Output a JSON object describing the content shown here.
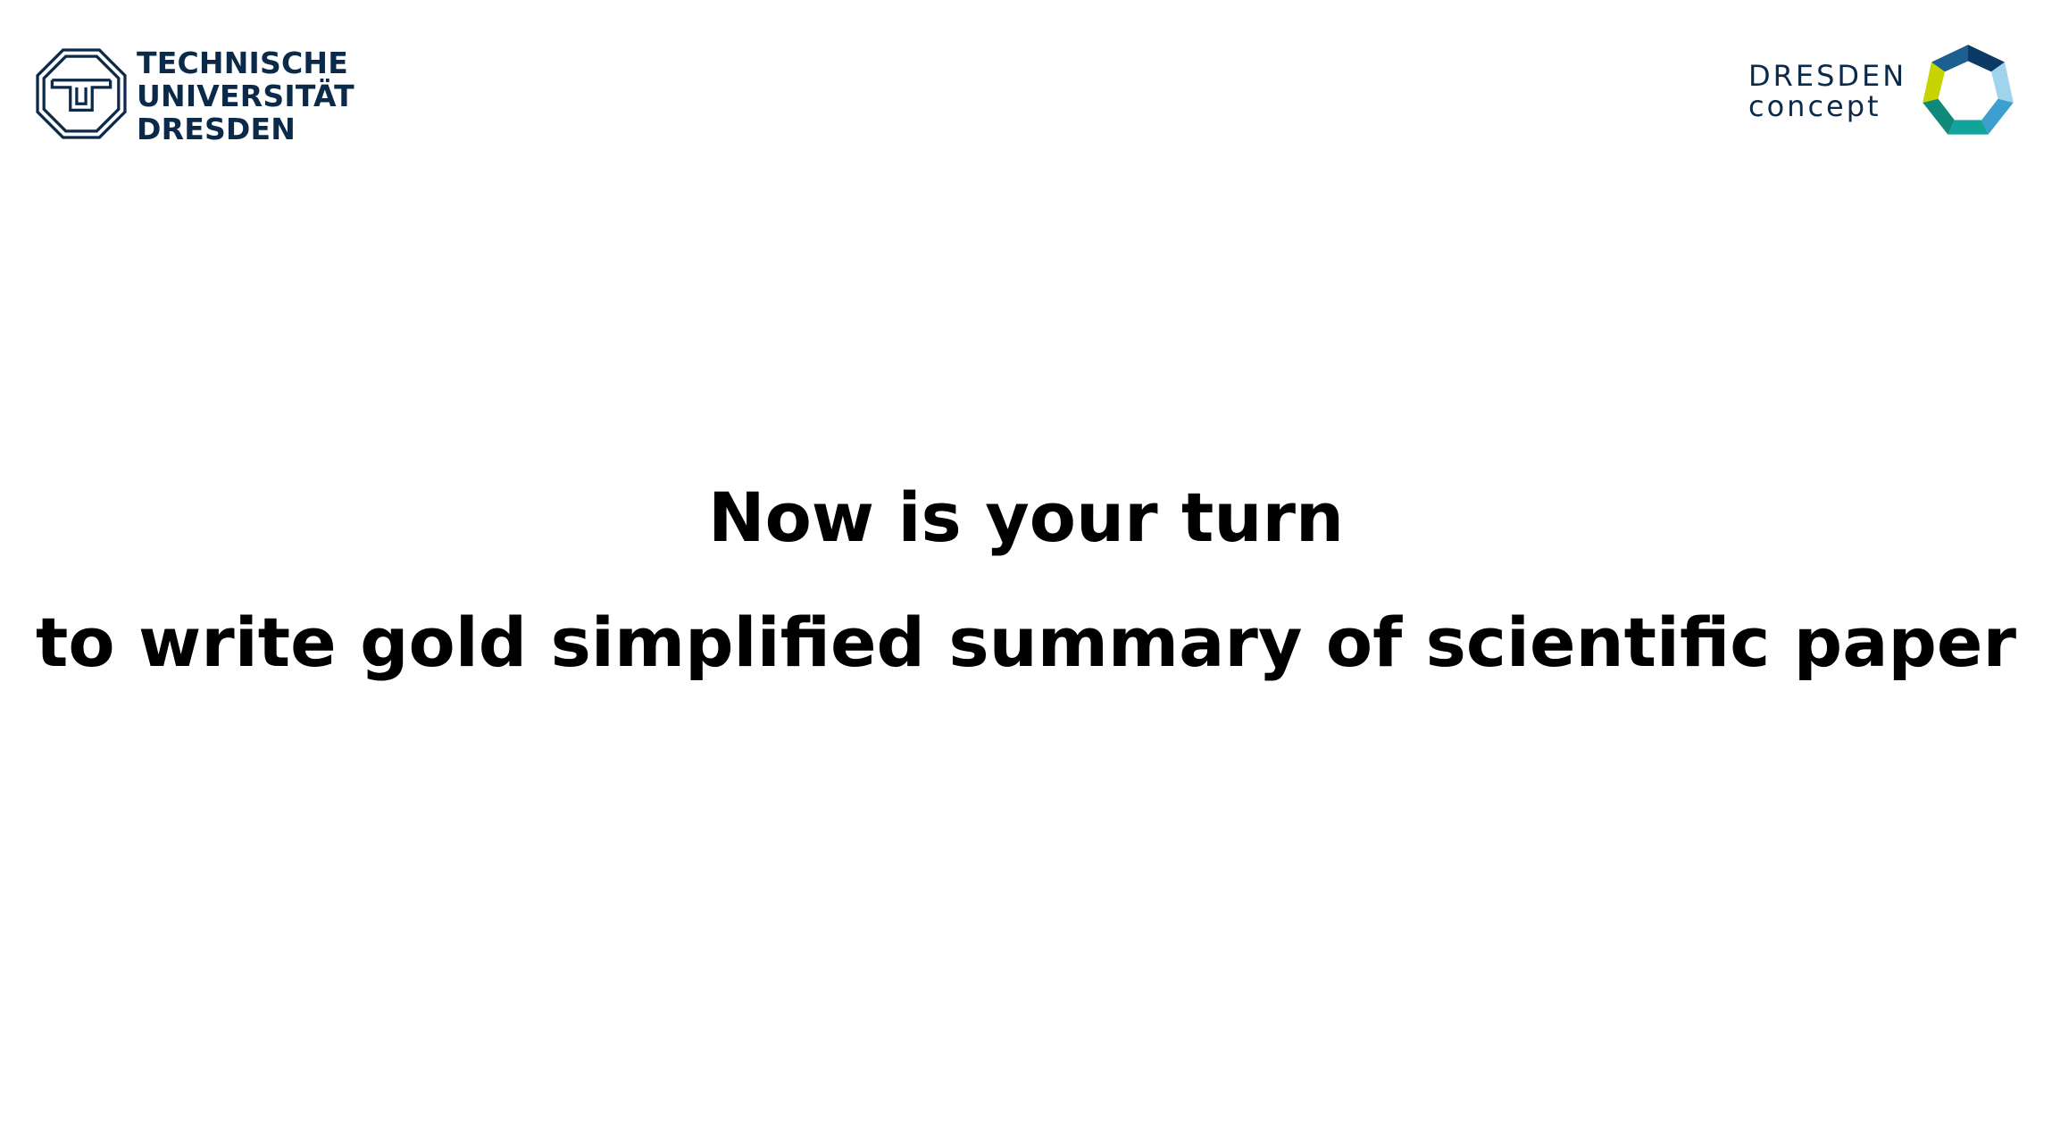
{
  "header": {
    "tud_logo": {
      "lines": [
        "TECHNISCHE",
        "UNIVERSITÄT",
        "DRESDEN"
      ],
      "color": "#0b2a4a",
      "icon": "tud-octagon-emblem-icon"
    },
    "dresden_concept_logo": {
      "line1": "DRESDEN",
      "line2": "concept",
      "color": "#0b2a4a",
      "icon": "dresden-concept-heptagon-icon",
      "segment_colors": [
        "#0b3a66",
        "#3d9fcf",
        "#9fd4ea",
        "#12a39b",
        "#0f8a7a",
        "#c8d400",
        "#7fbf3f"
      ]
    }
  },
  "main": {
    "title_line1": "Now is your turn",
    "title_line2": "to write gold simplified summary of scientific paper"
  }
}
